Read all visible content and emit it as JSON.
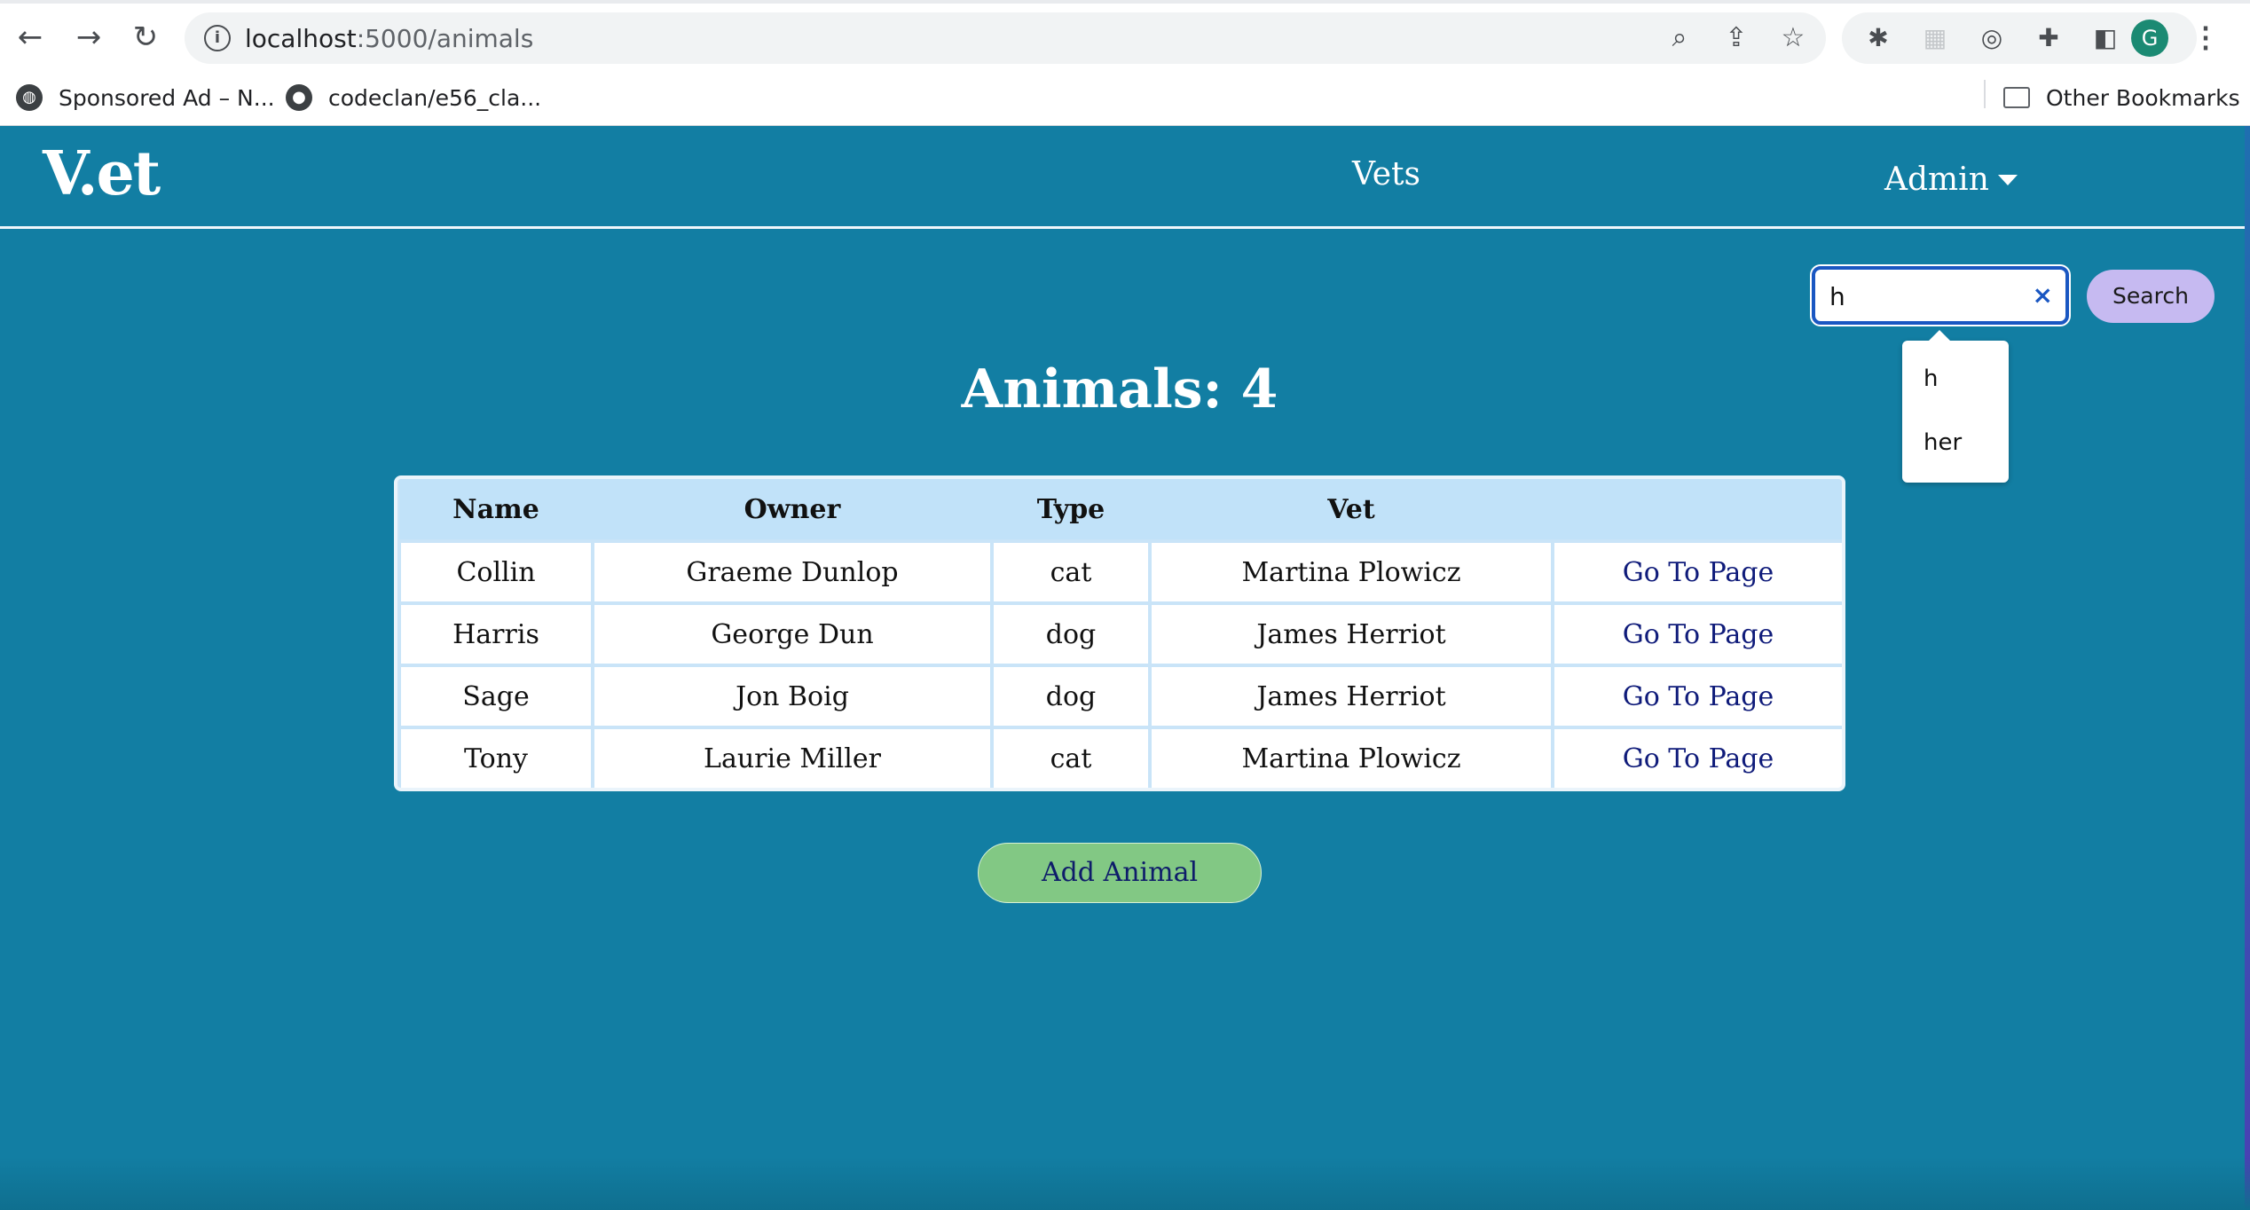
{
  "browser": {
    "url_host": "localhost",
    "url_path": ":5000/animals",
    "profile_initial": "G",
    "bookmarks": [
      {
        "label": "Sponsored Ad – N..."
      },
      {
        "label": "codeclan/e56_cla..."
      }
    ],
    "other_bookmarks": "Other Bookmarks"
  },
  "site": {
    "logo": "V.et",
    "nav": {
      "vets": "Vets",
      "admin": "Admin"
    },
    "search": {
      "value": "h",
      "clear": "×",
      "button": "Search",
      "suggestions": [
        "h",
        "her"
      ]
    },
    "heading": "Animals: 4",
    "table": {
      "headers": [
        "Name",
        "Owner",
        "Type",
        "Vet",
        ""
      ],
      "rows": [
        {
          "name": "Collin",
          "owner": "Graeme Dunlop",
          "type": "cat",
          "vet": "Martina Plowicz",
          "link": "Go To Page"
        },
        {
          "name": "Harris",
          "owner": "George Dun",
          "type": "dog",
          "vet": "James Herriot",
          "link": "Go To Page"
        },
        {
          "name": "Sage",
          "owner": "Jon Boig",
          "type": "dog",
          "vet": "James Herriot",
          "link": "Go To Page"
        },
        {
          "name": "Tony",
          "owner": "Laurie Miller",
          "type": "cat",
          "vet": "Martina Plowicz",
          "link": "Go To Page"
        }
      ]
    },
    "add_button": "Add Animal"
  },
  "colors": {
    "page_bg": "#127ea3",
    "table_header": "#c1e2f9",
    "search_button": "#c6baf1",
    "add_button": "#82c884",
    "link_text": "#0f1b7a"
  }
}
